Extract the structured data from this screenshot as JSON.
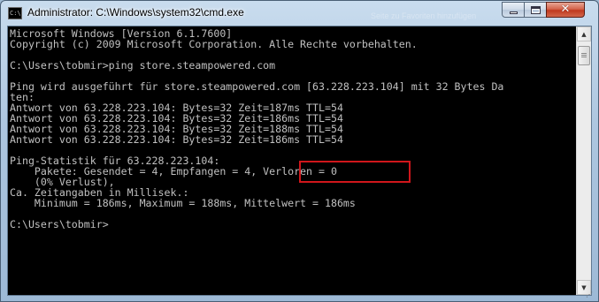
{
  "window": {
    "title": "Administrator: C:\\Windows\\system32\\cmd.exe",
    "icon_label": "C:\\",
    "ghost_title": "Seite zu Favoriten hinzufügen"
  },
  "controls": {
    "minimize_icon": "minimize-icon",
    "maximize_icon": "maximize-icon",
    "close_icon": "close-icon",
    "close_glyph": "✕"
  },
  "console": {
    "lines": [
      "Microsoft Windows [Version 6.1.7600]",
      "Copyright (c) 2009 Microsoft Corporation. Alle Rechte vorbehalten.",
      "",
      "C:\\Users\\tobmir>ping store.steampowered.com",
      "",
      "Ping wird ausgeführt für store.steampowered.com [63.228.223.104] mit 32 Bytes Da",
      "ten:",
      "Antwort von 63.228.223.104: Bytes=32 Zeit=187ms TTL=54",
      "Antwort von 63.228.223.104: Bytes=32 Zeit=186ms TTL=54",
      "Antwort von 63.228.223.104: Bytes=32 Zeit=188ms TTL=54",
      "Antwort von 63.228.223.104: Bytes=32 Zeit=186ms TTL=54",
      "",
      "Ping-Statistik für 63.228.223.104:",
      "    Pakete: Gesendet = 4, Empfangen = 4, Verloren = 0",
      "    (0% Verlust),",
      "Ca. Zeitangaben in Millisek.:",
      "    Minimum = 186ms, Maximum = 188ms, Mittelwert = 186ms",
      "",
      "C:\\Users\\tobmir>"
    ],
    "text_color": "#c0c0c0",
    "background_color": "#000000",
    "highlight_color": "#d0161b"
  },
  "scrollbar": {
    "up_glyph": "▲",
    "down_glyph": "▼"
  }
}
